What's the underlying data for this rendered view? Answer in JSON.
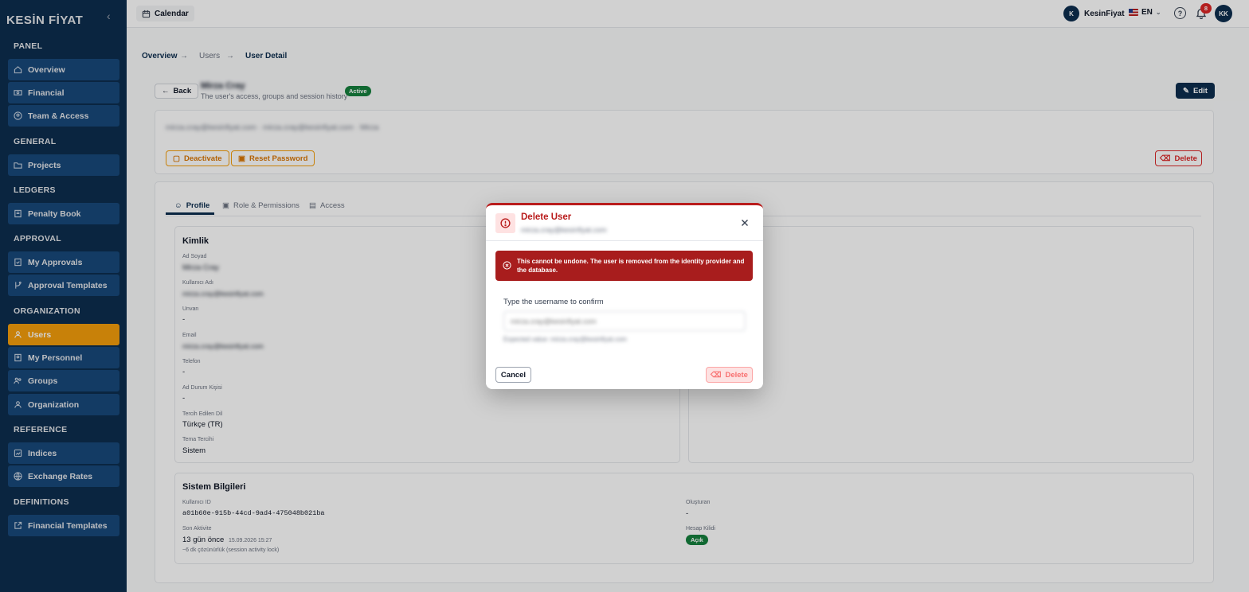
{
  "sidebar": {
    "logo": "KESİN FİYAT",
    "sections": [
      {
        "title": "PANEL",
        "items": [
          {
            "label": "Overview",
            "icon": "home-icon"
          },
          {
            "label": "Financial",
            "icon": "banknote-icon"
          },
          {
            "label": "Team & Access",
            "icon": "user-circle-icon"
          }
        ]
      },
      {
        "title": "GENERAL",
        "items": [
          {
            "label": "Projects",
            "icon": "folder-icon"
          }
        ]
      },
      {
        "title": "LEDGERS",
        "items": [
          {
            "label": "Penalty Book",
            "icon": "book-icon"
          }
        ]
      },
      {
        "title": "APPROVAL",
        "items": [
          {
            "label": "My Approvals",
            "icon": "clipboard-check-icon"
          },
          {
            "label": "Approval Templates",
            "icon": "git-branch-icon"
          }
        ]
      },
      {
        "title": "ORGANIZATION",
        "items": [
          {
            "label": "Users",
            "icon": "user-icon",
            "active": true
          },
          {
            "label": "My Personnel",
            "icon": "users-icon"
          },
          {
            "label": "Groups",
            "icon": "users-group-icon"
          },
          {
            "label": "Organization",
            "icon": "building-icon"
          }
        ]
      },
      {
        "title": "REFERENCE",
        "items": [
          {
            "label": "Indices",
            "icon": "chart-icon"
          },
          {
            "label": "Exchange Rates",
            "icon": "globe-icon"
          }
        ]
      },
      {
        "title": "DEFINITIONS",
        "items": [
          {
            "label": "Financial Templates",
            "icon": "external-link-icon"
          }
        ]
      }
    ]
  },
  "topbar": {
    "calendar_label": "Calendar",
    "workspace_initial": "K",
    "workspace_name": "KesinFiyat",
    "language": "EN",
    "notification_count": "8",
    "user_initials": "KK"
  },
  "breadcrumb": [
    "Overview",
    "Users",
    "User Detail"
  ],
  "header": {
    "back_label": "Back",
    "user_name": "Mirza Cray",
    "subtitle": "The user's access, groups and session history",
    "status_badge": "Active",
    "edit_label": "Edit"
  },
  "info_bar": "mirza.cray@kesinfiyat.com · mirza.cray@kesinfiyat.com · Mirza",
  "actions": {
    "deactivate": "Deactivate",
    "reset_password": "Reset Password",
    "delete": "Delete"
  },
  "tabs": [
    "Profile",
    "Role & Permissions",
    "Access"
  ],
  "kimlik": {
    "title": "Kimlik",
    "fields": [
      {
        "label": "Ad Soyad",
        "value": "Mirza Cray"
      },
      {
        "label": "Kullanıcı Adı",
        "value": "mirza.cray@kesinfiyat.com"
      },
      {
        "label": "Unvan",
        "value": "-"
      },
      {
        "label": "Email",
        "value": "mirza.cray@kesinfiyat.com"
      },
      {
        "label": "Telefon",
        "value": "-"
      },
      {
        "label": "Ad Durum Kişisi",
        "value": "-"
      },
      {
        "label": "Tercih Edilen Dil",
        "value": "Türkçe (TR)"
      },
      {
        "label": "Tema Tercihi",
        "value": "Sistem"
      }
    ]
  },
  "system": {
    "title": "Sistem Bilgileri",
    "user_id_label": "Kullanıcı ID",
    "user_id": "a01b60e-915b-44cd-9ad4-475048b021ba",
    "last_activity_label": "Son Aktivite",
    "last_activity": "13 gün önce",
    "last_activity_date": "15.09.2026 15:27",
    "activity_note": "~6 dk çözünürlük (session activity lock)",
    "created_by_label": "Oluşturan",
    "created_by": "-",
    "account_status_label": "Hesap Kilidi",
    "account_status": "Açık"
  },
  "modal": {
    "title": "Delete User",
    "subtitle": "mirza.cray@kesinfiyat.com",
    "warning": "This cannot be undone. The user is removed from the identity provider and the database.",
    "confirm_label": "Type the username to confirm",
    "input_placeholder": "mirza.cray@kesinfiyat.com",
    "hint": "Expected value: mirza.cray@kesinfiyat.com",
    "cancel_label": "Cancel",
    "delete_label": "Delete"
  },
  "colors": {
    "sidebar_bg": "#0d2e4f",
    "nav_item_bg": "#18487a",
    "active_nav": "#f59e0b",
    "danger": "#b91c1c",
    "success": "#15803d"
  }
}
